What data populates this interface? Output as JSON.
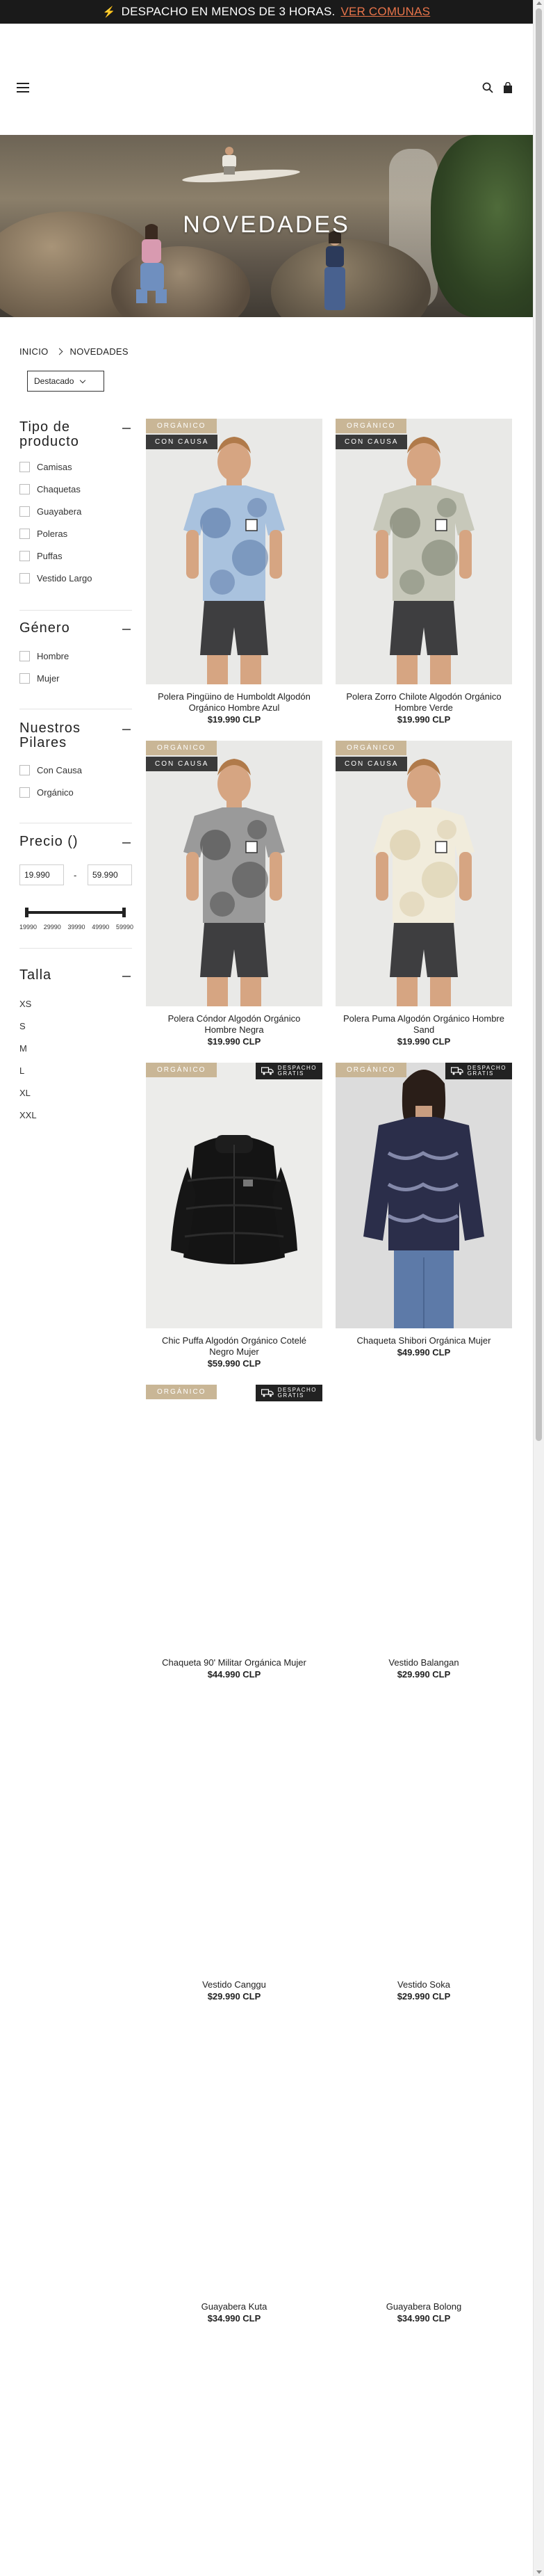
{
  "announcement": {
    "text": "DESPACHO EN MENOS DE 3 HORAS.",
    "link": "VER COMUNAS"
  },
  "hero": {
    "title": "NOVEDADES"
  },
  "breadcrumb": {
    "home": "INICIO",
    "current": "NOVEDADES"
  },
  "sort": {
    "selected": "Destacado"
  },
  "filters": {
    "tipo": {
      "title": "Tipo de producto",
      "items": [
        "Camisas",
        "Chaquetas",
        "Guayabera",
        "Poleras",
        "Puffas",
        "Vestido Largo"
      ]
    },
    "genero": {
      "title": "Género",
      "items": [
        "Hombre",
        "Mujer"
      ]
    },
    "pilares": {
      "title": "Nuestros Pilares",
      "items": [
        "Con Causa",
        "Orgánico"
      ]
    },
    "precio": {
      "title": "Precio ()",
      "min_value": "19.990",
      "max_value": "59.990",
      "dash": "-",
      "slider_labels": [
        "19990",
        "29990",
        "39990",
        "49990",
        "59990"
      ],
      "range_min": 19990,
      "range_max": 59990
    },
    "talla": {
      "title": "Talla",
      "items": [
        "XS",
        "S",
        "M",
        "L",
        "XL",
        "XXL"
      ]
    }
  },
  "badges": {
    "organic": "ORGÁNICO",
    "causa": "CON CAUSA",
    "ship_line1": "DESPACHO",
    "ship_line2": "GRATIS"
  },
  "products": [
    {
      "name": "Polera Pingüino de Humboldt Algodón Orgánico Hombre Azul",
      "price": "$19.990 CLP",
      "color": "#a9c2de",
      "dye": "#4f6fa0"
    },
    {
      "name": "Polera Zorro Chilote Algodón Orgánico Hombre Verde",
      "price": "$19.990 CLP",
      "color": "#c7c8ba",
      "dye": "#6d7361"
    },
    {
      "name": "Polera Cóndor Algodón Orgánico Hombre Negra",
      "price": "$19.990 CLP",
      "color": "#9a9a9a",
      "dye": "#3f3f3f"
    },
    {
      "name": "Polera Puma Algodón Orgánico Hombre Sand",
      "price": "$19.990 CLP",
      "color": "#f1ecdc",
      "dye": "#d6c79f"
    },
    {
      "name": "Chic Puffa Algodón Orgánico Cotelé Negro Mujer",
      "price": "$59.990 CLP",
      "color": "#1c1c1c",
      "dye": "#000000"
    },
    {
      "name": "Chaqueta Shibori Orgánica Mujer",
      "price": "$49.990 CLP",
      "color": "#2a2d45",
      "dye": "#8a8fb0"
    },
    {
      "name": "Chaqueta 90' Militar Orgánica Mujer",
      "price": "$44.990 CLP"
    },
    {
      "name": "Vestido Balangan",
      "price": "$29.990 CLP"
    },
    {
      "name": "Vestido Canggu",
      "price": "$29.990 CLP"
    },
    {
      "name": "Vestido Soka",
      "price": "$29.990 CLP"
    },
    {
      "name": "Guayabera Kuta",
      "price": "$34.990 CLP"
    },
    {
      "name": "Guayabera Bolong",
      "price": "$34.990 CLP"
    }
  ]
}
